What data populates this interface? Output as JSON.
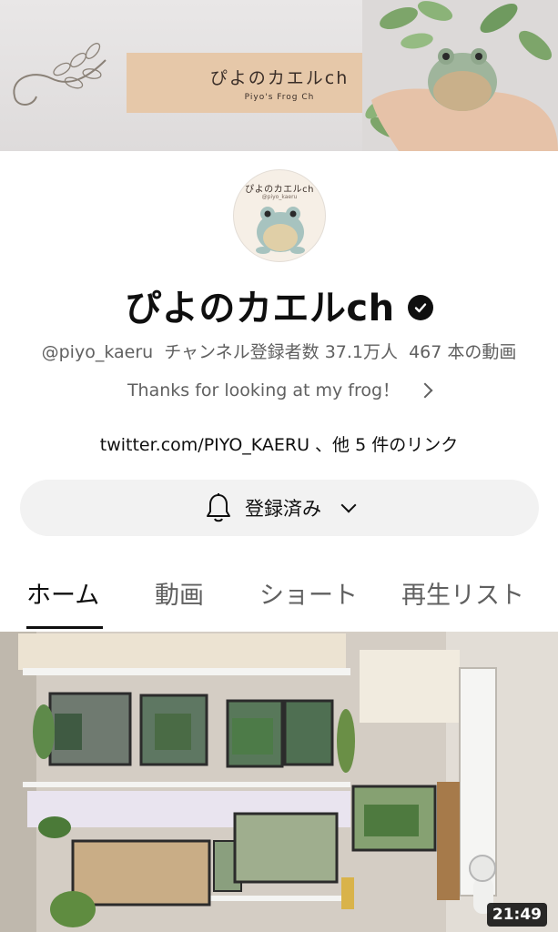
{
  "banner": {
    "title": "ぴよのカエルch",
    "subtitle": "Piyo's Frog Ch"
  },
  "avatar": {
    "name": "ぴよのカエルch",
    "handle": "@piyo_kaeru"
  },
  "channel": {
    "title": "ぴよのカエルch",
    "handle": "@piyo_kaeru",
    "subscribers": "チャンネル登録者数 37.1万人",
    "video_count": "467 本の動画",
    "description": "Thanks for looking at my frog！",
    "links": "twitter.com/PIYO_KAERU 、他 5 件のリンク"
  },
  "subscribe_button": {
    "label": "登録済み"
  },
  "tabs": [
    {
      "label": "ホーム",
      "active": true
    },
    {
      "label": "動画",
      "active": false
    },
    {
      "label": "ショート",
      "active": false
    },
    {
      "label": "再生リスト",
      "active": false
    }
  ],
  "video": {
    "duration": "21:49"
  },
  "icons": {
    "verified": "verified-check-icon",
    "bell": "bell-icon",
    "chevron_down": "chevron-down-icon",
    "chevron_right": "chevron-right-icon"
  },
  "colors": {
    "banner_plate": "#e6c8a9",
    "button_bg": "#f2f2f2",
    "secondary_text": "#606060",
    "primary_text": "#0f0f0f"
  }
}
